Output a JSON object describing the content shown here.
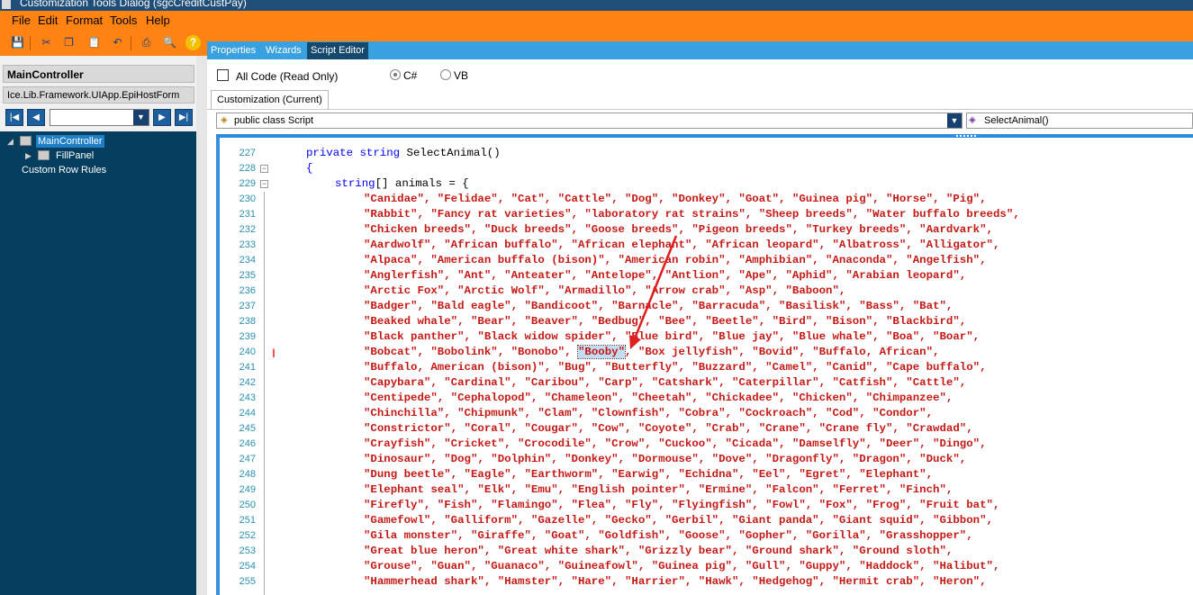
{
  "window": {
    "title": "Customization Tools Dialog (sgcCreditCustPay)"
  },
  "menu": [
    "File",
    "Edit",
    "Format",
    "Tools",
    "Help"
  ],
  "toolbar_icons": [
    "save-icon",
    "cut-icon",
    "copy-icon",
    "paste-icon",
    "undo-icon",
    "print-icon",
    "print-preview-icon",
    "help-icon"
  ],
  "left": {
    "controller_title": "MainController",
    "form_name": "Ice.Lib.Framework.UIApp.EpiHostForm",
    "tree": [
      {
        "label": "MainController",
        "selected": true
      },
      {
        "label": "FillPanel"
      },
      {
        "label": "Custom Row Rules"
      }
    ]
  },
  "tabs": [
    "Properties",
    "Wizards",
    "Script Editor"
  ],
  "active_tab": "Script Editor",
  "options": {
    "all_code_label": "All Code (Read Only)",
    "all_code_checked": false,
    "lang_csharp": "C#",
    "lang_vb": "VB",
    "selected_lang": "C#"
  },
  "subtab": "Customization (Current)",
  "class_combo": "public class Script",
  "method_combo": "SelectAnimal()",
  "editor": {
    "lines": [
      {
        "num": "227",
        "kw": "private string",
        "text": " SelectAnimal()",
        "indent": 1
      },
      {
        "num": "228",
        "text": "{",
        "indent": 1
      },
      {
        "num": "229",
        "kw": "string",
        "text": "[] animals = {",
        "indent": 2
      },
      {
        "num": "230",
        "s": "\"Canidae\", \"Felidae\", \"Cat\", \"Cattle\", \"Dog\", \"Donkey\", \"Goat\", \"Guinea pig\", \"Horse\", \"Pig\","
      },
      {
        "num": "231",
        "s": "\"Rabbit\", \"Fancy rat varieties\", \"laboratory rat strains\", \"Sheep breeds\", \"Water buffalo breeds\","
      },
      {
        "num": "232",
        "s": "\"Chicken breeds\", \"Duck breeds\", \"Goose breeds\", \"Pigeon breeds\", \"Turkey breeds\", \"Aardvark\","
      },
      {
        "num": "233",
        "s": "\"Aardwolf\", \"African buffalo\", \"African elephant\", \"African leopard\", \"Albatross\", \"Alligator\","
      },
      {
        "num": "234",
        "s": "\"Alpaca\", \"American buffalo (bison)\", \"American robin\", \"Amphibian\", \"Anaconda\", \"Angelfish\","
      },
      {
        "num": "235",
        "s": "\"Anglerfish\", \"Ant\", \"Anteater\", \"Antelope\", \"Antlion\", \"Ape\", \"Aphid\", \"Arabian leopard\","
      },
      {
        "num": "236",
        "s": "\"Arctic Fox\", \"Arctic Wolf\", \"Armadillo\", \"Arrow crab\", \"Asp\", \"Baboon\","
      },
      {
        "num": "237",
        "s": "\"Badger\", \"Bald eagle\", \"Bandicoot\", \"Barnacle\", \"Barracuda\", \"Basilisk\", \"Bass\", \"Bat\","
      },
      {
        "num": "238",
        "s": "\"Beaked whale\", \"Bear\", \"Beaver\", \"Bedbug\", \"Bee\", \"Beetle\", \"Bird\", \"Bison\", \"Blackbird\","
      },
      {
        "num": "239",
        "s": "\"Black panther\", \"Black widow spider\", \"Blue bird\", \"Blue jay\", \"Blue whale\", \"Boa\", \"Boar\","
      },
      {
        "num": "240",
        "s1": "\"Bobcat\", \"Bobolink\", \"Bonobo\", ",
        "hl": "\"Booby\"",
        "s2": ", \"Box jellyfish\", \"Bovid\", \"Buffalo, African\","
      },
      {
        "num": "241",
        "s": "\"Buffalo, American (bison)\", \"Bug\", \"Butterfly\", \"Buzzard\", \"Camel\", \"Canid\", \"Cape buffalo\","
      },
      {
        "num": "242",
        "s": "\"Capybara\", \"Cardinal\", \"Caribou\", \"Carp\", \"Catshark\", \"Caterpillar\", \"Catfish\", \"Cattle\","
      },
      {
        "num": "243",
        "s": "\"Centipede\", \"Cephalopod\", \"Chameleon\", \"Cheetah\", \"Chickadee\", \"Chicken\", \"Chimpanzee\","
      },
      {
        "num": "244",
        "s": "\"Chinchilla\", \"Chipmunk\", \"Clam\", \"Clownfish\", \"Cobra\", \"Cockroach\", \"Cod\", \"Condor\","
      },
      {
        "num": "245",
        "s": "\"Constrictor\", \"Coral\", \"Cougar\", \"Cow\", \"Coyote\", \"Crab\", \"Crane\", \"Crane fly\", \"Crawdad\","
      },
      {
        "num": "246",
        "s": "\"Crayfish\", \"Cricket\", \"Crocodile\", \"Crow\", \"Cuckoo\", \"Cicada\", \"Damselfly\", \"Deer\", \"Dingo\","
      },
      {
        "num": "247",
        "s": "\"Dinosaur\", \"Dog\", \"Dolphin\", \"Donkey\", \"Dormouse\", \"Dove\", \"Dragonfly\", \"Dragon\", \"Duck\","
      },
      {
        "num": "248",
        "s": "\"Dung beetle\", \"Eagle\", \"Earthworm\", \"Earwig\", \"Echidna\", \"Eel\", \"Egret\", \"Elephant\","
      },
      {
        "num": "249",
        "s": "\"Elephant seal\", \"Elk\", \"Emu\", \"English pointer\", \"Ermine\", \"Falcon\", \"Ferret\", \"Finch\","
      },
      {
        "num": "250",
        "s": "\"Firefly\", \"Fish\", \"Flamingo\", \"Flea\", \"Fly\", \"Flyingfish\", \"Fowl\", \"Fox\", \"Frog\", \"Fruit bat\","
      },
      {
        "num": "251",
        "s": "\"Gamefowl\", \"Galliform\", \"Gazelle\", \"Gecko\", \"Gerbil\", \"Giant panda\", \"Giant squid\", \"Gibbon\","
      },
      {
        "num": "252",
        "s": "\"Gila monster\", \"Giraffe\", \"Goat\", \"Goldfish\", \"Goose\", \"Gopher\", \"Gorilla\", \"Grasshopper\","
      },
      {
        "num": "253",
        "s": "\"Great blue heron\", \"Great white shark\", \"Grizzly bear\", \"Ground shark\", \"Ground sloth\","
      },
      {
        "num": "254",
        "s": "\"Grouse\", \"Guan\", \"Guanaco\", \"Guineafowl\", \"Guinea pig\", \"Gull\", \"Guppy\", \"Haddock\", \"Halibut\","
      },
      {
        "num": "255",
        "s": "\"Hammerhead shark\", \"Hamster\", \"Hare\", \"Harrier\", \"Hawk\", \"Hedgehog\", \"Hermit crab\", \"Heron\","
      }
    ]
  },
  "colors": {
    "accent": "#fe8312",
    "tab_strip": "#3aa1e0",
    "tree_bg": "#063e5f",
    "string": "#c41a16",
    "keyword": "#0000ff",
    "arrow": "#e02020"
  }
}
